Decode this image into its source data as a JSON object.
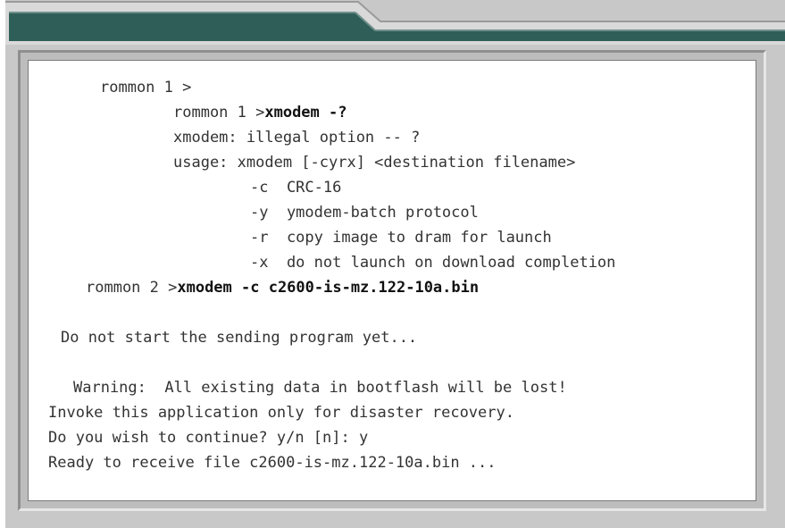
{
  "terminal": {
    "lines": [
      {
        "prefix": "rommon 1 >",
        "cmd": ""
      },
      {
        "prefix": "rommon 1 >",
        "cmd": "xmodem -?"
      },
      {
        "prefix": "xmodem: illegal option -- ?",
        "cmd": ""
      },
      {
        "prefix": "usage: xmodem [-cyrx] <destination filename>",
        "cmd": ""
      },
      {
        "prefix": "-c  CRC-16",
        "cmd": ""
      },
      {
        "prefix": "-y  ymodem-batch protocol",
        "cmd": ""
      },
      {
        "prefix": "-r  copy image to dram for launch",
        "cmd": ""
      },
      {
        "prefix": "-x  do not launch on download completion",
        "cmd": ""
      },
      {
        "prefix": "rommon 2 >",
        "cmd": "xmodem -c c2600-is-mz.122-10a.bin"
      },
      {
        "prefix": "Do not start the sending program yet...",
        "cmd": ""
      },
      {
        "prefix": "Warning:  All existing data in bootflash will be lost!",
        "cmd": ""
      },
      {
        "prefix": "Invoke this application only for disaster recovery.",
        "cmd": ""
      },
      {
        "prefix": "Do you wish to continue? y/n [n]: y",
        "cmd": ""
      },
      {
        "prefix": "Ready to receive file c2600-is-mz.122-10a.bin ...",
        "cmd": ""
      }
    ]
  },
  "colors": {
    "tab_dark": "#2f5e58",
    "frame_gray": "#c8c8c8",
    "text": "#333333"
  }
}
